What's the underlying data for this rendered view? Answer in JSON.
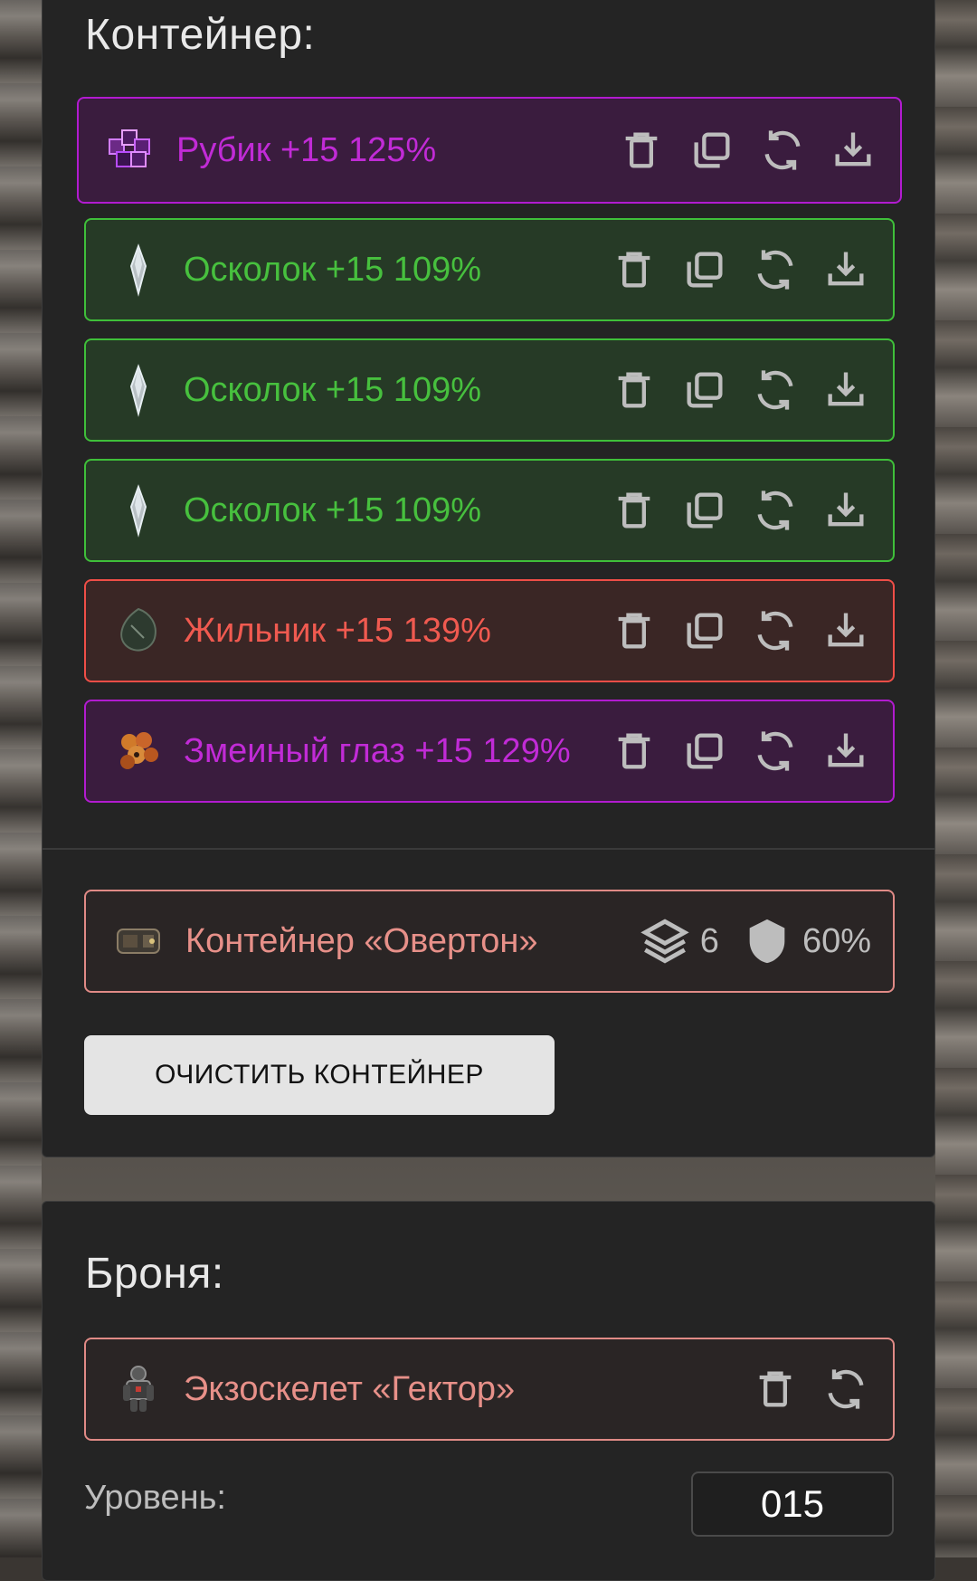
{
  "container_section": {
    "title": "Контейнер:",
    "items": [
      {
        "label": "Рубик +15 125%",
        "rarity": "purple"
      },
      {
        "label": "Осколок +15 109%",
        "rarity": "green"
      },
      {
        "label": "Осколок +15 109%",
        "rarity": "green"
      },
      {
        "label": "Осколок +15 109%",
        "rarity": "green"
      },
      {
        "label": "Жильник +15 139%",
        "rarity": "red"
      },
      {
        "label": "Змеиный глаз +15 129%",
        "rarity": "purple"
      }
    ],
    "container": {
      "name": "Контейнер «Овертон»",
      "slots": "6",
      "protection": "60%"
    },
    "clear_button": "ОЧИСТИТЬ КОНТЕЙНЕР"
  },
  "armor_section": {
    "title": "Броня:",
    "item": {
      "label": "Экзоскелет «Гектор»"
    },
    "level_label": "Уровень:",
    "level_value": "015"
  },
  "colors": {
    "purple": "#c12bd6",
    "green": "#47c03e",
    "red": "#f05a50",
    "pink": "#e79089",
    "panel_bg": "#242424"
  },
  "icons": {
    "item_actions": [
      "trash-icon",
      "copy-icon",
      "refresh-icon",
      "download-icon"
    ],
    "armor_actions": [
      "trash-icon",
      "refresh-icon"
    ],
    "container_stats": [
      "layers-icon",
      "shield-icon"
    ]
  }
}
